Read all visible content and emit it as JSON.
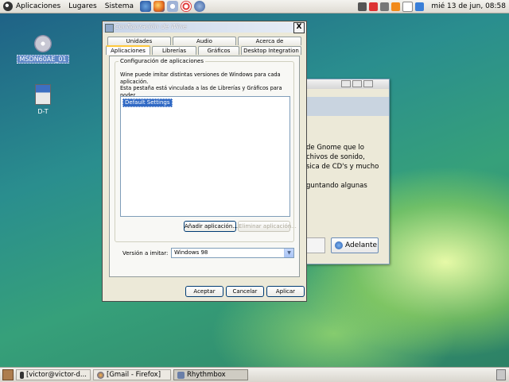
{
  "top_panel": {
    "menus": [
      "Aplicaciones",
      "Lugares",
      "Sistema"
    ],
    "launchers": [
      "firefox-icon",
      "evolution-icon",
      "help-icon",
      "network-icon"
    ],
    "tray_icons": [
      "volume-icon",
      "gem-icon",
      "mail-icon",
      "update-icon",
      "network-tray-icon"
    ],
    "clock": "mié 13 de jun, 08:58"
  },
  "desktop": {
    "icons": [
      {
        "label": "MSDN60AE_01",
        "icon": "cdrom-icon"
      },
      {
        "label": "D-T",
        "icon": "media-icon"
      }
    ]
  },
  "background_window": {
    "text_lines": [
      "de Gnome que lo",
      "chivos de sonido,",
      "sica de CD's y mucho",
      "",
      "guntando algunas"
    ],
    "next_button": "Adelante"
  },
  "wine_dialog": {
    "title": "Configuración de Wine",
    "close_label": "X",
    "tabs_row1": [
      "Unidades",
      "Audio",
      "Acerca de"
    ],
    "tabs_row2": [
      "Aplicaciones",
      "Librerías",
      "Gráficos",
      "Desktop Integration"
    ],
    "active_tab": "Aplicaciones",
    "group_title": "Configuración de aplicaciones",
    "description": "Wine puede imitar distintas versiones de Windows para cada aplicación.\nEsta pestaña está vinculada a las de Librerías y Gráficos para poder\ncambiar en ellas la configuración global y/o la de por aplicación.",
    "app_list": [
      "Default Settings"
    ],
    "add_button": "Añadir aplicación...",
    "remove_button": "Eliminar aplicación...",
    "version_label": "Versión a imitar:",
    "version_value": "Windows 98",
    "ok_button": "Aceptar",
    "cancel_button": "Cancelar",
    "apply_button": "Aplicar"
  },
  "bottom_panel": {
    "tasks": [
      {
        "label": "[victor@victor-d...",
        "active": false
      },
      {
        "label": "[Gmail - Firefox]",
        "active": false
      },
      {
        "label": "Rhythmbox",
        "active": true
      }
    ]
  }
}
